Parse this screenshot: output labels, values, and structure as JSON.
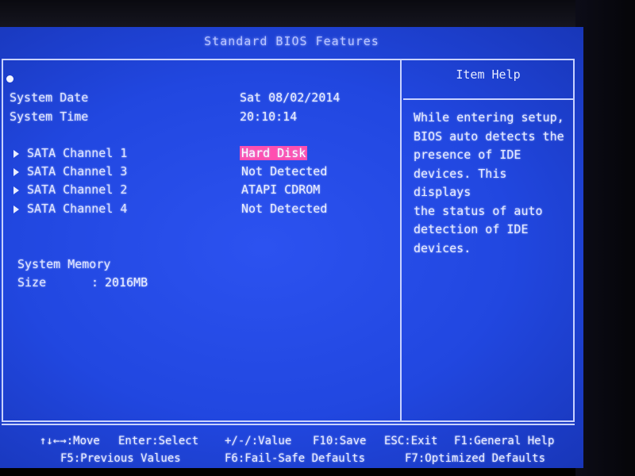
{
  "header": {
    "title": "Standard BIOS Features"
  },
  "system": {
    "date_label": "System Date",
    "date_value": "Sat 08/02/2014",
    "time_label": "System Time",
    "time_value": "20:10:14"
  },
  "sata": [
    {
      "label": "SATA Channel 1",
      "value": "Hard Disk",
      "selected": true
    },
    {
      "label": "SATA Channel 3",
      "value": "Not Detected",
      "selected": false
    },
    {
      "label": "SATA Channel 2",
      "value": "ATAPI CDROM",
      "selected": false
    },
    {
      "label": "SATA Channel 4",
      "value": "Not Detected",
      "selected": false
    }
  ],
  "memory": {
    "heading": "System Memory",
    "size_label": "Size",
    "size_sep": ":",
    "size_value": "2016MB"
  },
  "help": {
    "title": "Item Help",
    "text": "While entering setup,\nBIOS auto detects the\npresence of IDE\ndevices. This displays\nthe status of auto\ndetection of IDE\ndevices."
  },
  "footer": {
    "move": "↑↓←→:Move",
    "enter": "Enter:Select",
    "value": "+/-/:Value",
    "save": "F10:Save",
    "exit": "ESC:Exit",
    "f1": "F1:General Help",
    "f5": "F5:Previous Values",
    "f6": "F6:Fail-Safe Defaults",
    "f7": "F7:Optimized Defaults"
  },
  "colors": {
    "background": "#2147e0",
    "highlight": "#ff4fb0",
    "text": "#e8ecff"
  }
}
